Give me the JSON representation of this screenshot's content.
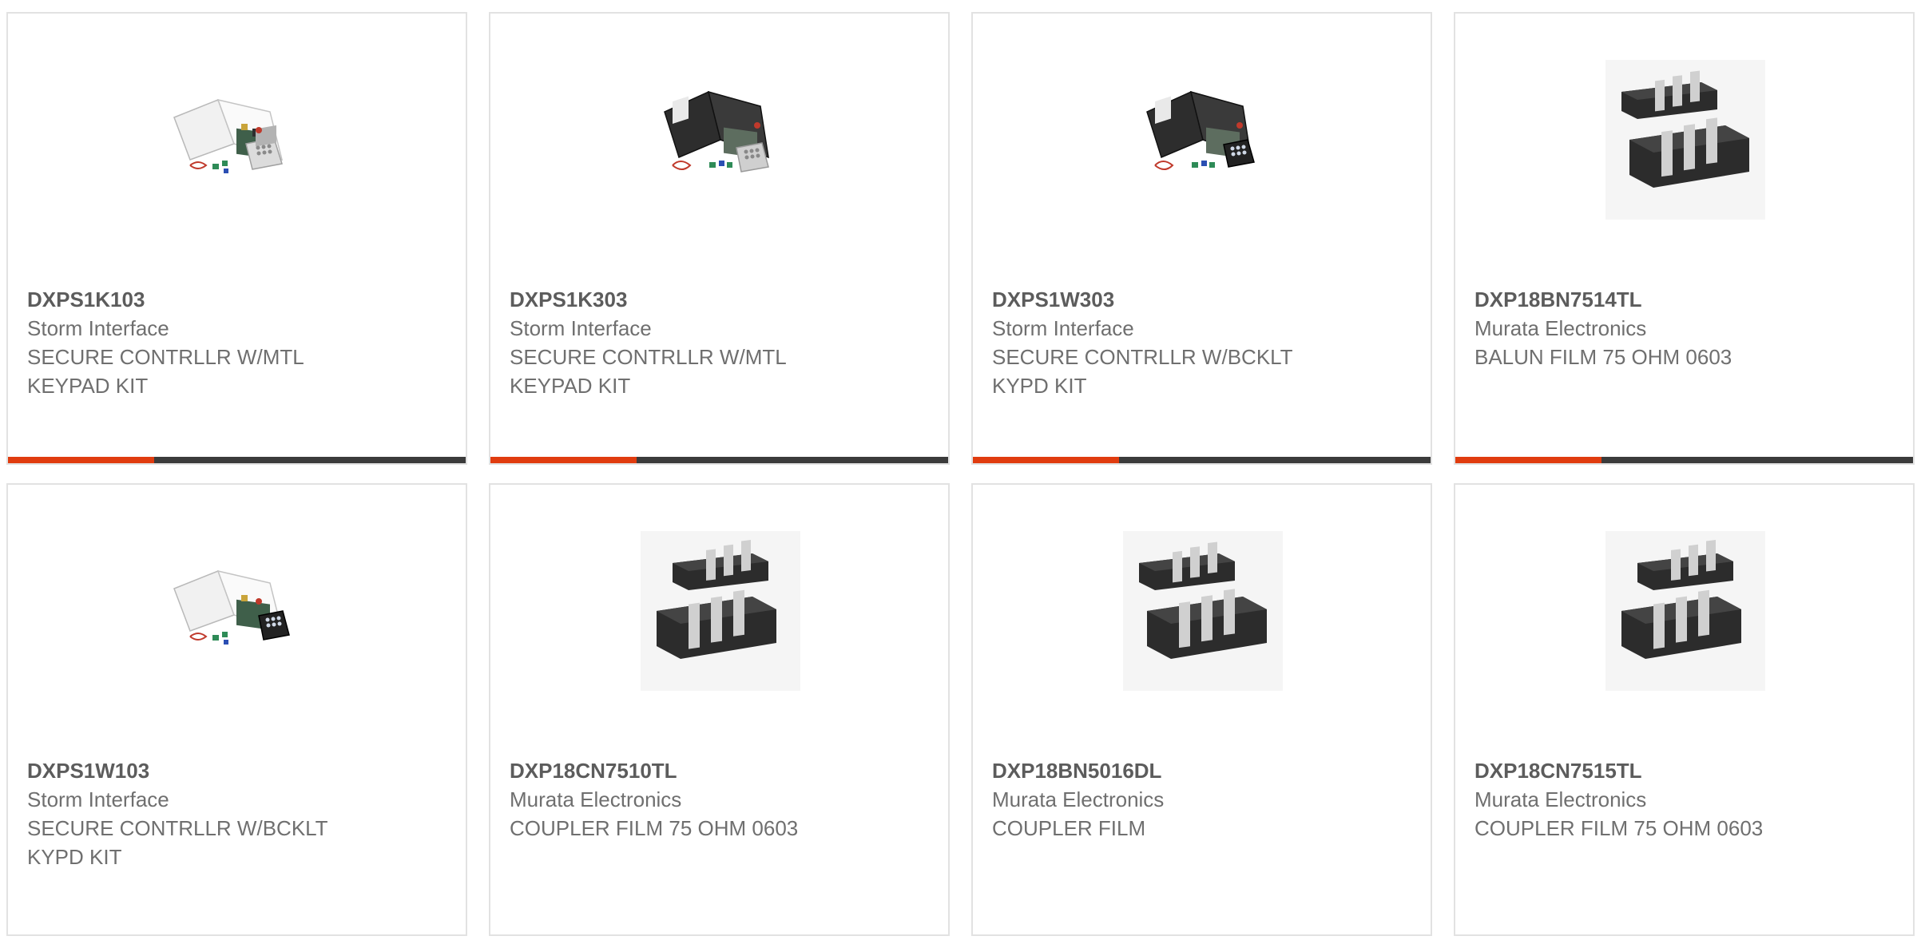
{
  "accent_color": "#e03c0f",
  "bar_color": "#3b3b3b",
  "products": [
    {
      "part_number": "DXPS1K103",
      "manufacturer": "Storm Interface",
      "description": "SECURE CONTRLLR W/MTL KEYPAD KIT",
      "image": "access-control-kit-white-enclosure-metal-keypad-image",
      "bar_progress": 0.32
    },
    {
      "part_number": "DXPS1K303",
      "manufacturer": "Storm Interface",
      "description": "SECURE CONTRLLR W/MTL KEYPAD KIT",
      "image": "access-control-kit-black-enclosure-metal-keypad-image",
      "bar_progress": 0.32
    },
    {
      "part_number": "DXPS1W303",
      "manufacturer": "Storm Interface",
      "description": "SECURE CONTRLLR W/BCKLT KYPD KIT",
      "image": "access-control-kit-black-enclosure-backlit-keypad-image",
      "bar_progress": 0.32
    },
    {
      "part_number": "DXP18BN7514TL",
      "manufacturer": "Murata Electronics",
      "description": "BALUN FILM 75 OHM 0603",
      "image": "smd-chip-component-image",
      "bar_progress": 0.32
    },
    {
      "part_number": "DXPS1W103",
      "manufacturer": "Storm Interface",
      "description": "SECURE CONTRLLR W/BCKLT KYPD KIT",
      "image": "access-control-kit-white-enclosure-backlit-keypad-image",
      "bar_progress": 0
    },
    {
      "part_number": "DXP18CN7510TL",
      "manufacturer": "Murata Electronics",
      "description": "COUPLER FILM 75 OHM 0603",
      "image": "smd-chip-component-image",
      "bar_progress": 0
    },
    {
      "part_number": "DXP18BN5016DL",
      "manufacturer": "Murata Electronics",
      "description": "COUPLER FILM",
      "image": "smd-chip-component-image",
      "bar_progress": 0
    },
    {
      "part_number": "DXP18CN7515TL",
      "manufacturer": "Murata Electronics",
      "description": "COUPLER FILM 75 OHM 0603",
      "image": "smd-chip-component-image",
      "bar_progress": 0
    }
  ]
}
